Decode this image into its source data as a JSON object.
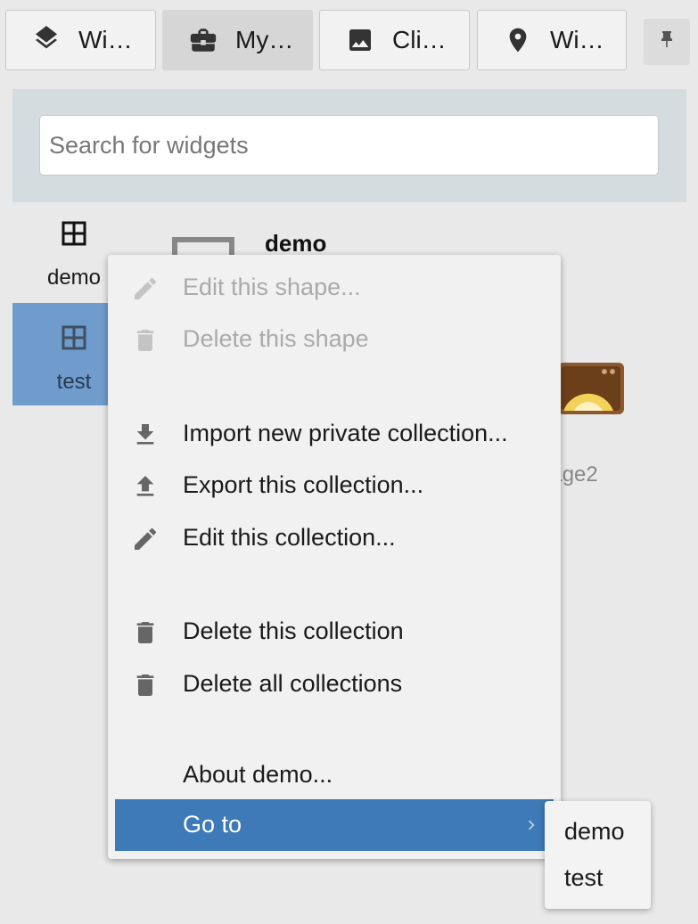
{
  "tabs": [
    {
      "label": "Wi…",
      "icon": "layers-icon"
    },
    {
      "label": "My…",
      "icon": "briefcase-icon",
      "active": true
    },
    {
      "label": "Cli…",
      "icon": "image-icon"
    },
    {
      "label": "Wi…",
      "icon": "location-pin-icon"
    }
  ],
  "search": {
    "placeholder": "Search for widgets"
  },
  "collections": [
    {
      "label": "demo",
      "icon": "grid-icon"
    },
    {
      "label": "test",
      "icon": "grid-icon",
      "selected": true
    }
  ],
  "background": {
    "collection_title": "demo",
    "widget_label": "page2"
  },
  "context_menu": {
    "edit_shape": "Edit this shape...",
    "delete_shape": "Delete this shape",
    "import_collection": "Import new private collection...",
    "export_collection": "Export this collection...",
    "edit_collection": "Edit this collection...",
    "delete_collection": "Delete this collection",
    "delete_all": "Delete all collections",
    "about": "About demo...",
    "goto": "Go to"
  },
  "goto_submenu": [
    "demo",
    "test"
  ],
  "colors": {
    "highlight": "#3d7ab7",
    "selected_collection": "#6f9ccc",
    "search_panel": "#d5dce0",
    "icon_gray": "#6b6b6b"
  }
}
